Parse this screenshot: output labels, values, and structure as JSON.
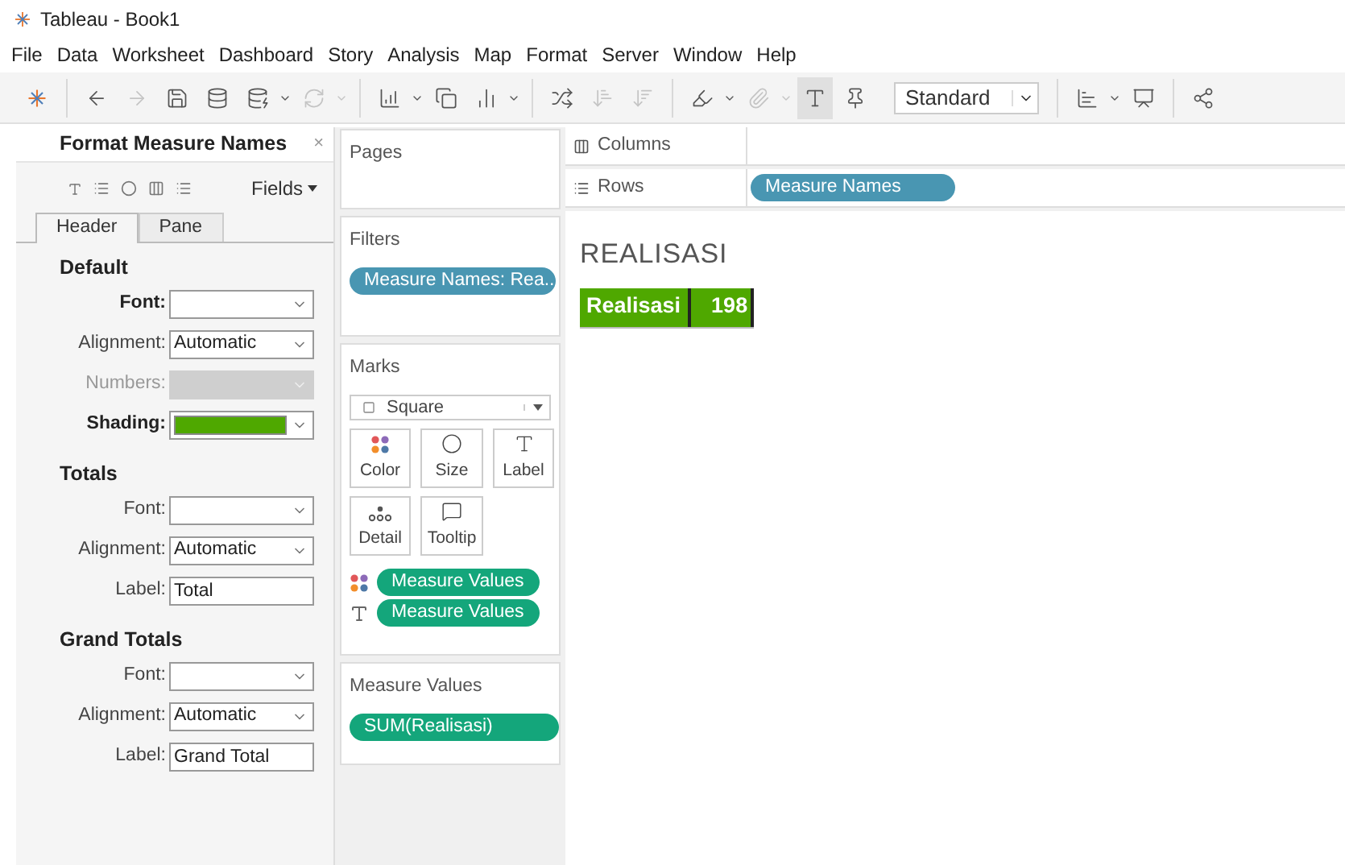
{
  "window": {
    "title": "Tableau - Book1"
  },
  "menu": [
    "File",
    "Data",
    "Worksheet",
    "Dashboard",
    "Story",
    "Analysis",
    "Map",
    "Format",
    "Server",
    "Window",
    "Help"
  ],
  "toolbar": {
    "items": [
      {
        "disabled": false,
        "selected": false
      },
      {
        "disabled": true,
        "selected": false
      },
      {
        "disabled": false,
        "selected": false
      },
      {
        "disabled": false,
        "selected": false
      },
      {
        "disabled": false,
        "selected": false
      },
      {
        "disabled": true,
        "selected": false
      },
      {
        "disabled": false,
        "selected": false
      },
      {
        "disabled": false,
        "selected": false
      },
      {
        "disabled": false,
        "selected": false
      },
      {
        "disabled": false,
        "selected": false
      },
      {
        "disabled": true,
        "selected": false
      },
      {
        "disabled": true,
        "selected": false
      },
      {
        "disabled": false,
        "selected": false
      },
      {
        "disabled": true,
        "selected": false
      },
      {
        "disabled": false,
        "selected": true
      },
      {
        "disabled": false,
        "selected": false
      },
      {
        "disabled": false,
        "selected": false
      },
      {
        "disabled": false,
        "selected": false
      },
      {
        "disabled": false,
        "selected": false
      }
    ],
    "view_select": "Standard"
  },
  "format_panel": {
    "title": "Format Measure Names",
    "close": "×",
    "fields_button": "Fields",
    "tabs": [
      {
        "label": "Header",
        "selected": true
      },
      {
        "label": "Pane",
        "selected": false
      }
    ],
    "sections": [
      {
        "title": "Default",
        "rows": [
          {
            "label": "Font:",
            "kind": "select",
            "value": "",
            "emphasized": true,
            "disabled": false
          },
          {
            "label": "Alignment:",
            "kind": "select",
            "value": "Automatic",
            "emphasized": false,
            "disabled": false
          },
          {
            "label": "Numbers:",
            "kind": "select",
            "value": "",
            "emphasized": false,
            "disabled": true
          },
          {
            "label": "Shading:",
            "kind": "color",
            "value": "",
            "emphasized": true,
            "disabled": false
          }
        ]
      },
      {
        "title": "Totals",
        "rows": [
          {
            "label": "Font:",
            "kind": "select",
            "value": "",
            "emphasized": false,
            "disabled": false
          },
          {
            "label": "Alignment:",
            "kind": "select",
            "value": "Automatic",
            "emphasized": false,
            "disabled": false
          },
          {
            "label": "Label:",
            "kind": "text",
            "value": "Total",
            "emphasized": false,
            "disabled": false
          }
        ]
      },
      {
        "title": "Grand Totals",
        "rows": [
          {
            "label": "Font:",
            "kind": "select",
            "value": "",
            "emphasized": false,
            "disabled": false
          },
          {
            "label": "Alignment:",
            "kind": "select",
            "value": "Automatic",
            "emphasized": false,
            "disabled": false
          },
          {
            "label": "Label:",
            "kind": "text",
            "value": "Grand Total",
            "emphasized": false,
            "disabled": false
          }
        ]
      }
    ]
  },
  "pages": {
    "title": "Pages"
  },
  "filters": {
    "title": "Filters",
    "pills": [
      "Measure Names: Rea.."
    ]
  },
  "marks": {
    "title": "Marks",
    "mark_type": "Square",
    "cards": [
      "Color",
      "Size",
      "Label",
      "Detail",
      "Tooltip"
    ],
    "fields": [
      {
        "kind": "color",
        "label": "Measure Values"
      },
      {
        "kind": "label",
        "label": "Measure Values"
      }
    ]
  },
  "measure_values": {
    "title": "Measure Values",
    "pills": [
      "SUM(Realisasi)"
    ]
  },
  "shelves": [
    {
      "kind": "columns",
      "label": "Columns"
    },
    {
      "kind": "rows",
      "label": "Rows",
      "pills": [
        "Measure Names"
      ]
    }
  ],
  "view": {
    "title": "REALISASI",
    "rows": [
      {
        "header": "Realisasi",
        "value": "198"
      }
    ]
  }
}
